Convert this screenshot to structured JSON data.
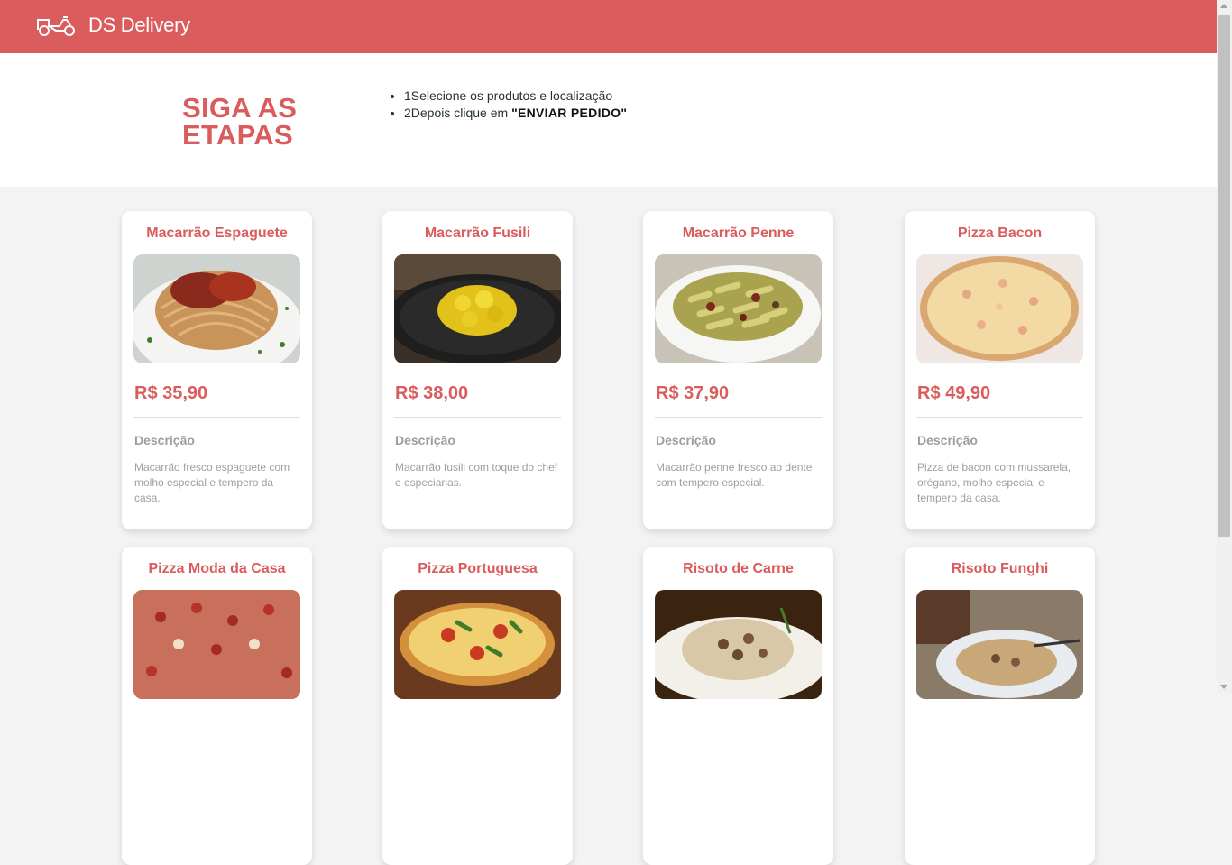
{
  "header": {
    "brand": "DS Delivery",
    "logo_icon": "motorcycle-icon",
    "color": "#da5c5c"
  },
  "steps": {
    "title_line1": "SIGA AS",
    "title_line2": "ETAPAS",
    "step1": "1Selecione os produtos e localização",
    "step2_prefix": "2Depois clique em ",
    "step2_emphasis": "\"ENVIAR PEDIDO\""
  },
  "products": [
    {
      "name": "Macarrão Espaguete",
      "price": "R$ 35,90",
      "description_label": "Descrição",
      "description": "Macarrão fresco espaguete com molho especial e tempero da casa."
    },
    {
      "name": "Macarrão Fusili",
      "price": "R$ 38,00",
      "description_label": "Descrição",
      "description": "Macarrão fusili com toque do chef e especiarias."
    },
    {
      "name": "Macarrão Penne",
      "price": "R$ 37,90",
      "description_label": "Descrição",
      "description": "Macarrão penne fresco ao dente com tempero especial."
    },
    {
      "name": "Pizza Bacon",
      "price": "R$ 49,90",
      "description_label": "Descrição",
      "description": "Pizza de bacon com mussarela, orégano, molho especial e tempero da casa."
    },
    {
      "name": "Pizza Moda da Casa",
      "price": "",
      "description_label": "",
      "description": ""
    },
    {
      "name": "Pizza Portuguesa",
      "price": "",
      "description_label": "",
      "description": ""
    },
    {
      "name": "Risoto de Carne",
      "price": "",
      "description_label": "",
      "description": ""
    },
    {
      "name": "Risoto Funghi",
      "price": "",
      "description_label": "",
      "description": ""
    }
  ]
}
